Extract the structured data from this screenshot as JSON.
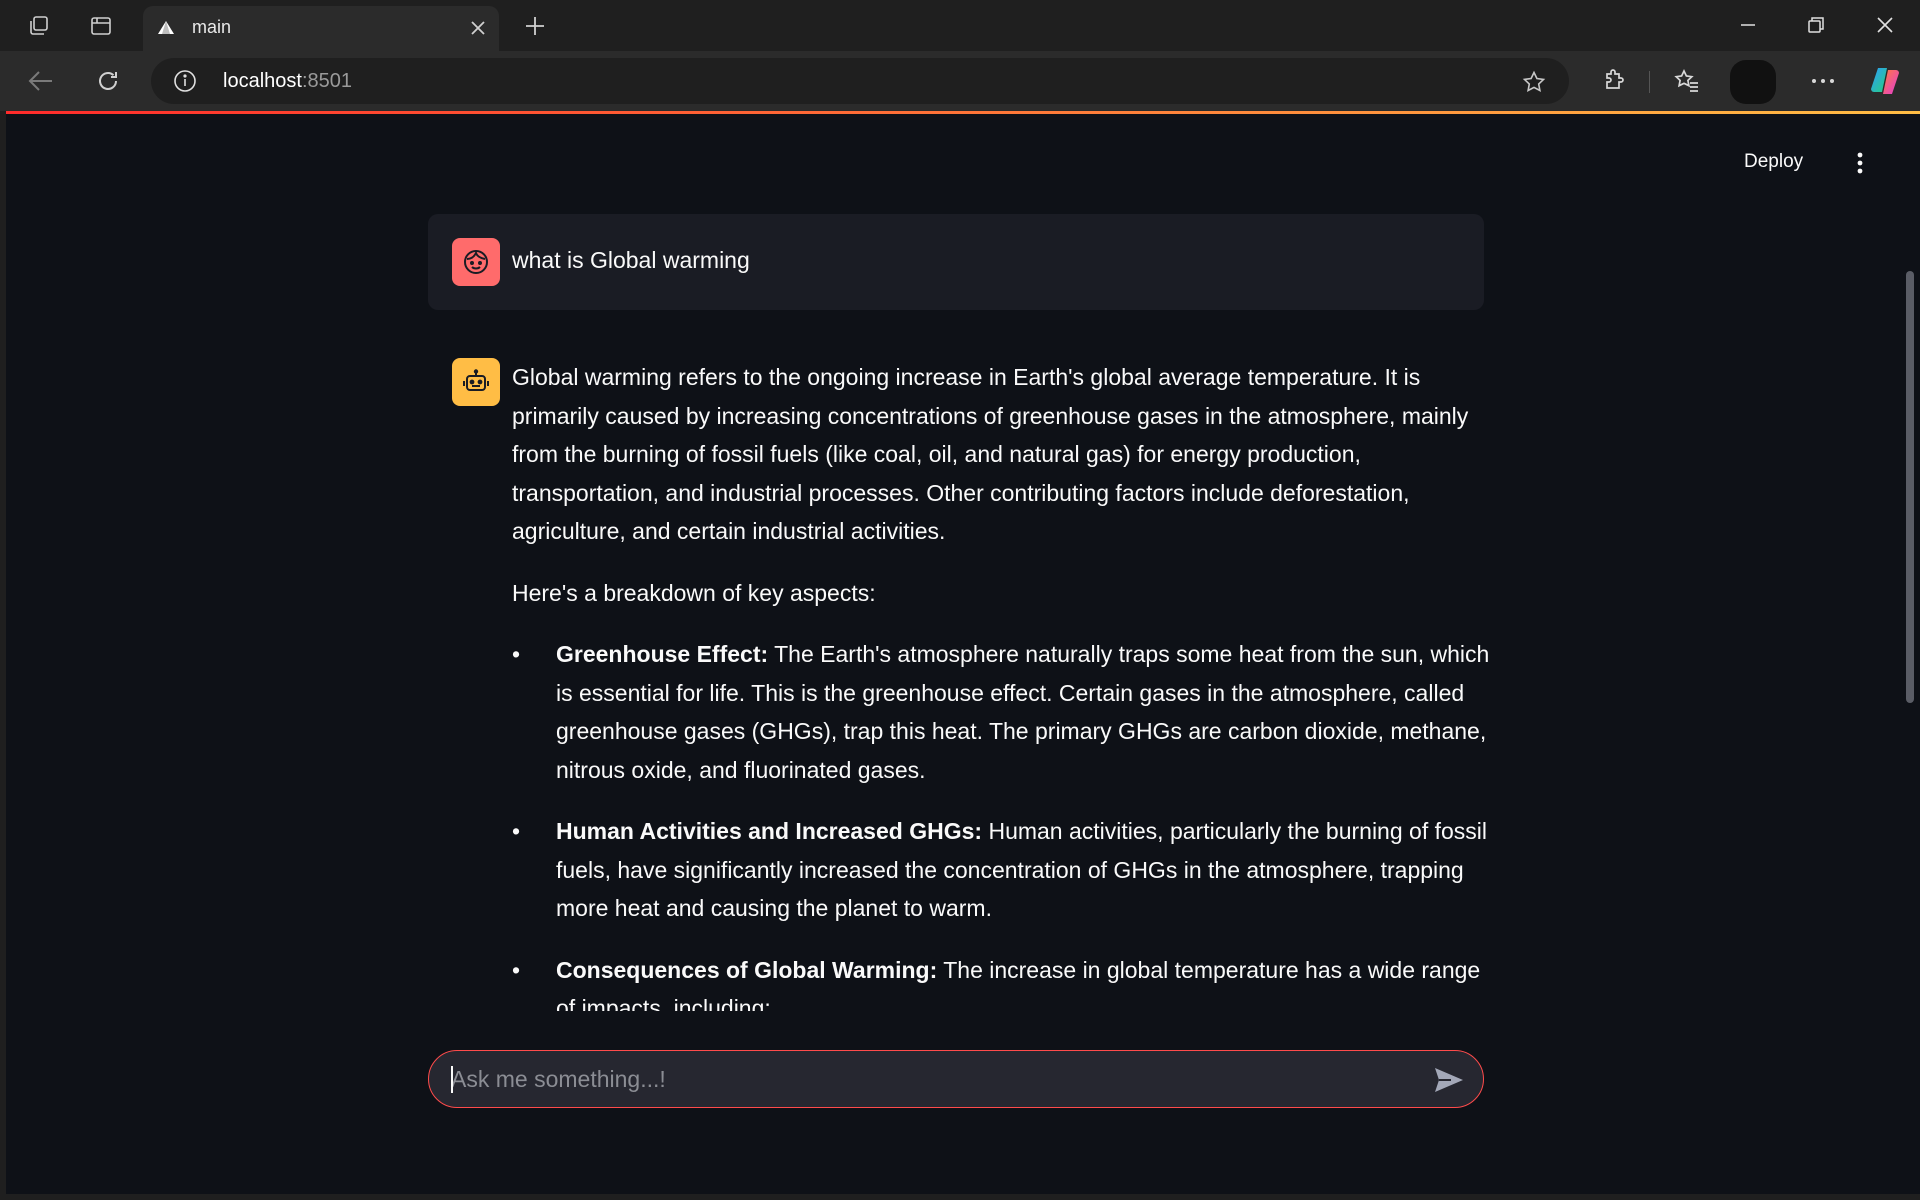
{
  "browser": {
    "tab": {
      "title": "main"
    },
    "address": {
      "host": "localhost",
      "port": ":8501"
    }
  },
  "app": {
    "header": {
      "deploy_label": "Deploy"
    },
    "messages": [
      {
        "role": "user",
        "text": "what is Global warming"
      },
      {
        "role": "assistant",
        "paragraphs": [
          "Global warming refers to the ongoing increase in Earth's global average temperature. It is primarily caused by increasing concentrations of greenhouse gases in the atmosphere, mainly from the burning of fossil fuels (like coal, oil, and natural gas) for energy production, transportation, and industrial processes. Other contributing factors include deforestation, agriculture, and certain industrial activities.",
          "Here's a breakdown of key aspects:"
        ],
        "bullets": [
          {
            "title": "Greenhouse Effect:",
            "text": " The Earth's atmosphere naturally traps some heat from the sun, which is essential for life. This is the greenhouse effect. Certain gases in the atmosphere, called greenhouse gases (GHGs), trap this heat. The primary GHGs are carbon dioxide, methane, nitrous oxide, and fluorinated gases."
          },
          {
            "title": "Human Activities and Increased GHGs:",
            "text": " Human activities, particularly the burning of fossil fuels, have significantly increased the concentration of GHGs in the atmosphere, trapping more heat and causing the planet to warm."
          },
          {
            "title": "Consequences of Global Warming:",
            "text": " The increase in global temperature has a wide range of impacts, including:"
          }
        ]
      }
    ],
    "chat_input": {
      "placeholder": "Ask me something...!",
      "value": ""
    }
  },
  "colors": {
    "page_bg": "#0e1117",
    "user_avatar": "#ff6b6b",
    "bot_avatar": "#ffbd45",
    "input_border": "#ff4b4b"
  }
}
